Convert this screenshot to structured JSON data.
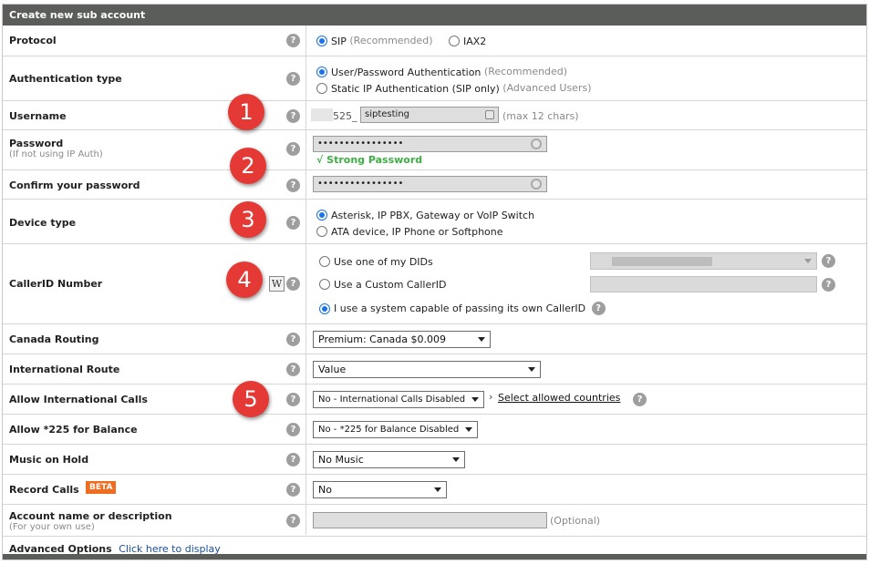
{
  "header": {
    "title": "Create new sub account"
  },
  "protocol": {
    "label": "Protocol",
    "options": [
      {
        "label": "SIP",
        "note": "(Recommended)",
        "checked": true
      },
      {
        "label": "IAX2",
        "note": "",
        "checked": false
      }
    ]
  },
  "auth_type": {
    "label": "Authentication type",
    "options": [
      {
        "label": "User/Password Authentication",
        "note": "(Recommended)",
        "checked": true
      },
      {
        "label": "Static IP Authentication (SIP only)",
        "note": "(Advanced Users)",
        "checked": false
      }
    ]
  },
  "username": {
    "label": "Username",
    "prefix": "525_",
    "value": "siptesting",
    "hint": "(max 12 chars)"
  },
  "password": {
    "label": "Password",
    "sublabel": "(If not using IP Auth)",
    "value": "••••••••••••••••",
    "strength": "√ Strong Password"
  },
  "confirm_password": {
    "label": "Confirm your password",
    "value": "••••••••••••••••"
  },
  "device_type": {
    "label": "Device type",
    "options": [
      {
        "label": "Asterisk, IP PBX, Gateway or VoIP Switch",
        "checked": true
      },
      {
        "label": "ATA device, IP Phone or Softphone",
        "checked": false
      }
    ]
  },
  "callerid": {
    "label": "CallerID Number",
    "w_icon": "W",
    "options": [
      {
        "label": "Use one of my DIDs",
        "checked": false
      },
      {
        "label": "Use a Custom CallerID",
        "checked": false
      },
      {
        "label": "I use a system capable of passing its own CallerID",
        "checked": true
      }
    ]
  },
  "canada_routing": {
    "label": "Canada Routing",
    "selected": "Premium: Canada $0.009"
  },
  "international_route": {
    "label": "International Route",
    "selected": "Value"
  },
  "allow_international": {
    "label": "Allow International Calls",
    "selected": "No - International Calls Disabled",
    "link_prefix": "›",
    "link": "Select allowed countries"
  },
  "allow_225": {
    "label": "Allow *225 for Balance",
    "selected": "No - *225 for Balance Disabled"
  },
  "music_on_hold": {
    "label": "Music on Hold",
    "selected": "No Music"
  },
  "record_calls": {
    "label": "Record Calls",
    "badge": "BETA",
    "selected": "No"
  },
  "account_name": {
    "label": "Account name or description",
    "sublabel": "(For your own use)",
    "value": "",
    "hint": "(Optional)"
  },
  "advanced": {
    "label": "Advanced Options",
    "link": "Click here to display"
  },
  "help_glyph": "?",
  "annotations": [
    "1",
    "2",
    "3",
    "4",
    "5"
  ],
  "colors": {
    "header_bg": "#5b5d5b",
    "badge": "#e53935",
    "beta": "#f06d1f",
    "strong": "#3cb043",
    "radio": "#1a73e8"
  }
}
